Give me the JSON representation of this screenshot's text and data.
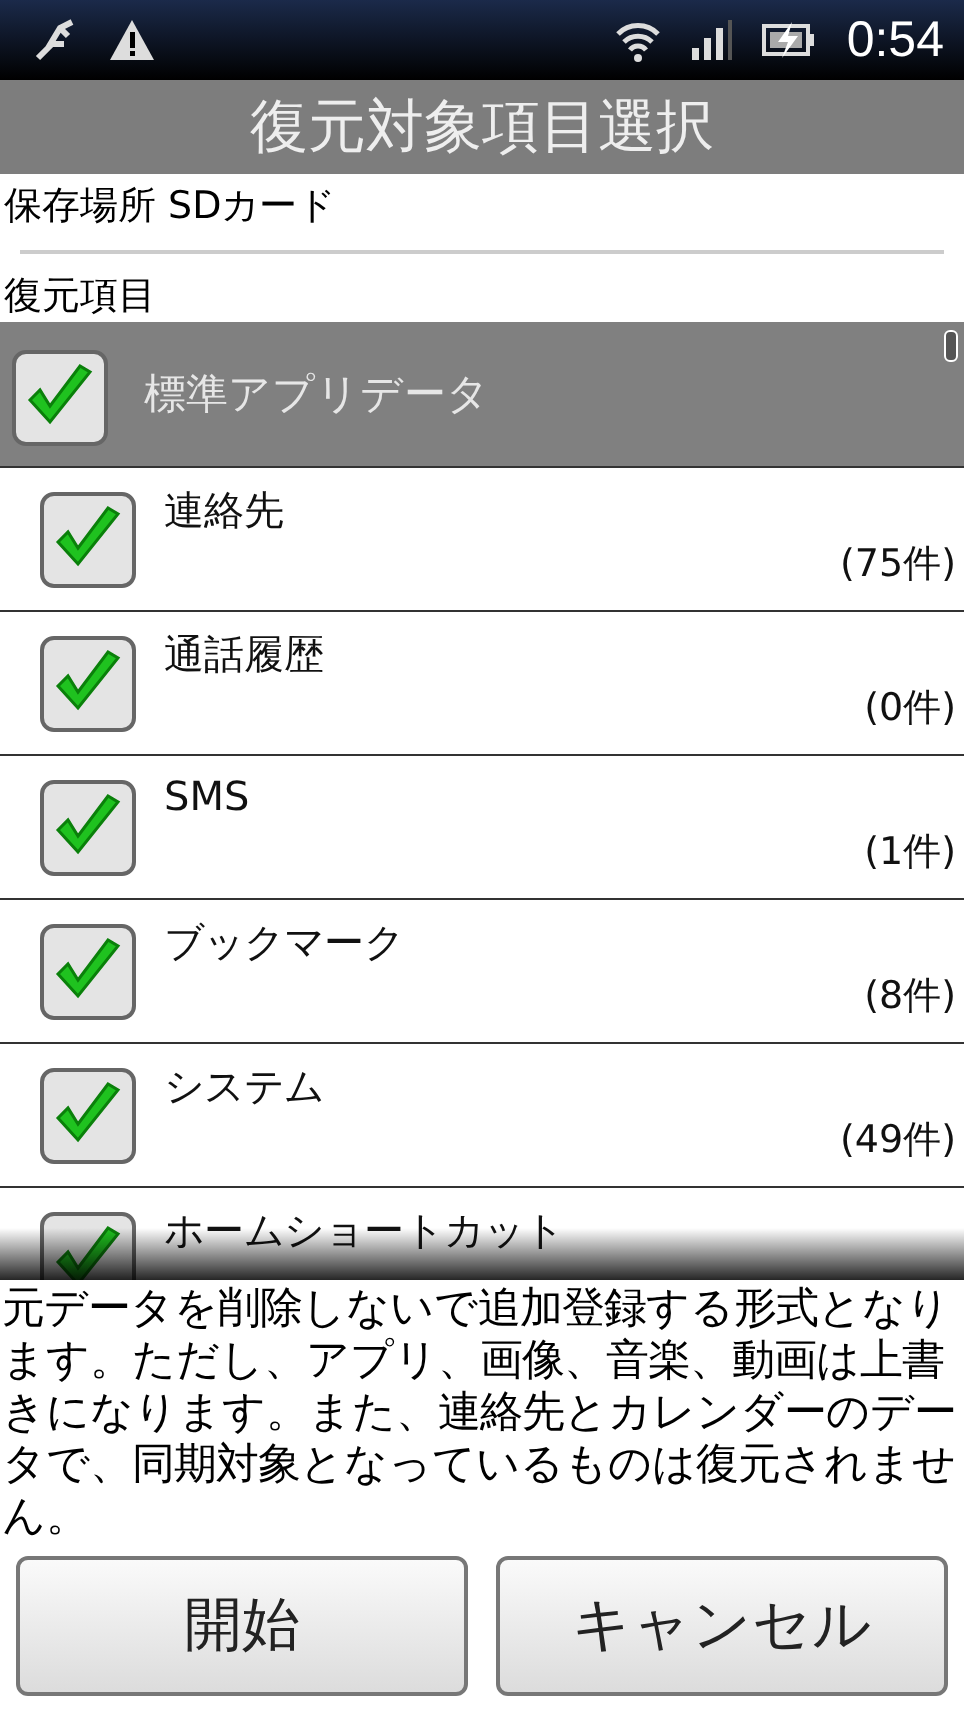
{
  "status_bar": {
    "time": "0:54"
  },
  "title": "復元対象項目選択",
  "storage": {
    "label": "保存場所 SDカード"
  },
  "section_label": "復元項目",
  "group": {
    "label": "標準アプリデータ",
    "checked": true
  },
  "items": [
    {
      "label": "連絡先",
      "count": "(75件)",
      "checked": true
    },
    {
      "label": "通話履歴",
      "count": "(0件)",
      "checked": true
    },
    {
      "label": "SMS",
      "count": "(1件)",
      "checked": true
    },
    {
      "label": "ブックマーク",
      "count": "(8件)",
      "checked": true
    },
    {
      "label": "システム",
      "count": "(49件)",
      "checked": true
    },
    {
      "label": "ホームショートカット",
      "checked": true
    }
  ],
  "notice": "元データを削除しないで追加登録する形式となります。ただし、アプリ、画像、音楽、動画は上書きになります。また、連絡先とカレンダーのデータで、同期対象となっているものは復元されません。",
  "buttons": [
    {
      "label": "開始"
    },
    {
      "label": "キャンセル"
    }
  ]
}
